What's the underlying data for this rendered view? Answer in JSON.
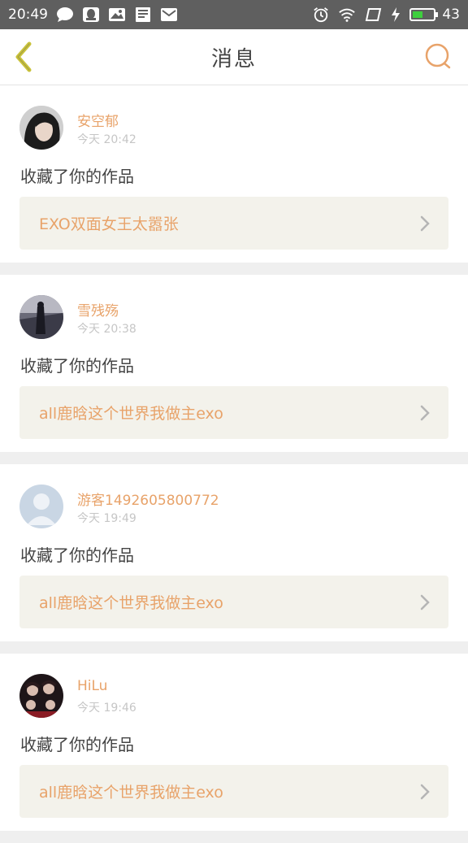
{
  "status_bar": {
    "time": "20:49",
    "battery": "43"
  },
  "header": {
    "title": "消息"
  },
  "messages": [
    {
      "username": "安空郁",
      "timestamp": "今天  20:42",
      "action": "收藏了你的作品",
      "work_title": "EXO双面女王太嚣张"
    },
    {
      "username": "雪残殇",
      "timestamp": "今天  20:38",
      "action": "收藏了你的作品",
      "work_title": "all鹿晗这个世界我做主exo"
    },
    {
      "username": "游客1492605800772",
      "timestamp": "今天  19:49",
      "action": "收藏了你的作品",
      "work_title": "all鹿晗这个世界我做主exo"
    },
    {
      "username": "HiLu",
      "timestamp": "今天  19:46",
      "action": "收藏了你的作品",
      "work_title": "all鹿晗这个世界我做主exo"
    }
  ],
  "colors": {
    "accent": "#e8a36a",
    "back_arrow": "#c9c23a",
    "status_bar_bg": "#5f5f5f"
  }
}
